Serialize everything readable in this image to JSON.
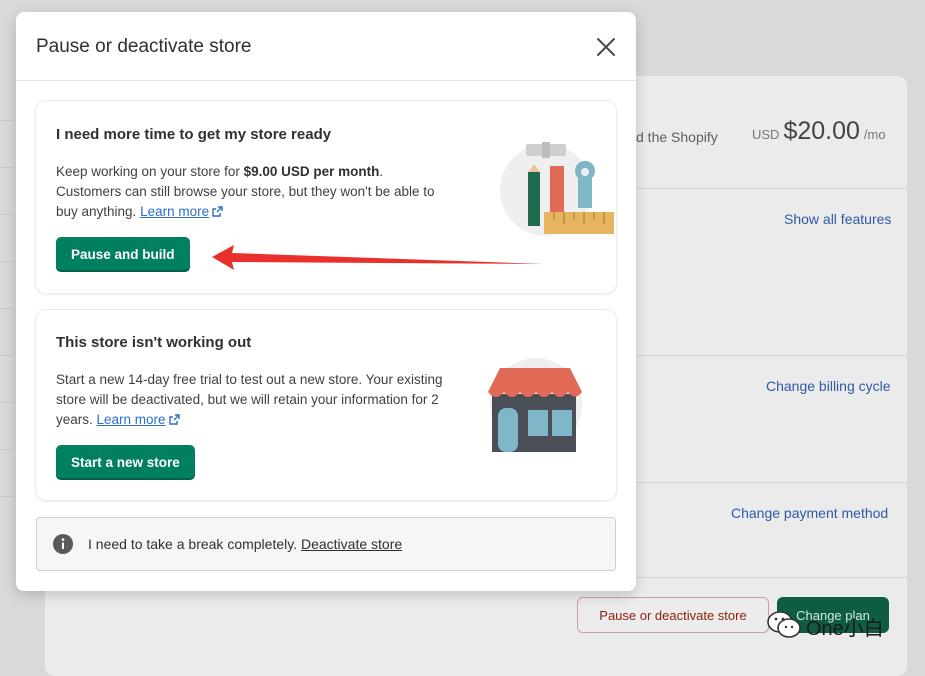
{
  "background": {
    "plan_text": "d the Shopify",
    "price_currency": "USD",
    "price_amount": "$20.00",
    "price_period": "/mo",
    "show_all_features": "Show all features",
    "change_billing_cycle": "Change billing cycle",
    "change_payment_method": "Change payment method",
    "pause_deactivate_button": "Pause or deactivate store",
    "change_plan_button": "Change plan"
  },
  "modal": {
    "title": "Pause or deactivate store",
    "pause_card": {
      "title": "I need more time to get my store ready",
      "desc_prefix": "Keep working on your store for ",
      "desc_bold": "$9.00 USD per month",
      "desc_suffix": ". Customers can still browse your store, but they won't be able to buy anything. ",
      "learn_more": "Learn more",
      "button": "Pause and build"
    },
    "new_store_card": {
      "title": "This store isn't working out",
      "desc": "Start a new 14-day free trial to test out a new store. Your existing store will be deactivated, but we will retain your information for 2 years. ",
      "learn_more": "Learn more",
      "button": "Start a new store"
    },
    "notice": {
      "text": "I need to take a break completely. ",
      "link": "Deactivate store"
    }
  },
  "watermark": "One小白",
  "colors": {
    "primary_button": "#00805f",
    "link": "#2c6ecb",
    "annotation_arrow": "#e8312c",
    "critical_text": "#8e1f0b"
  },
  "icons": [
    "close-icon",
    "external-link-icon",
    "info-icon",
    "tools-illustration",
    "storefront-illustration",
    "wechat-icon",
    "annotation-arrow"
  ]
}
